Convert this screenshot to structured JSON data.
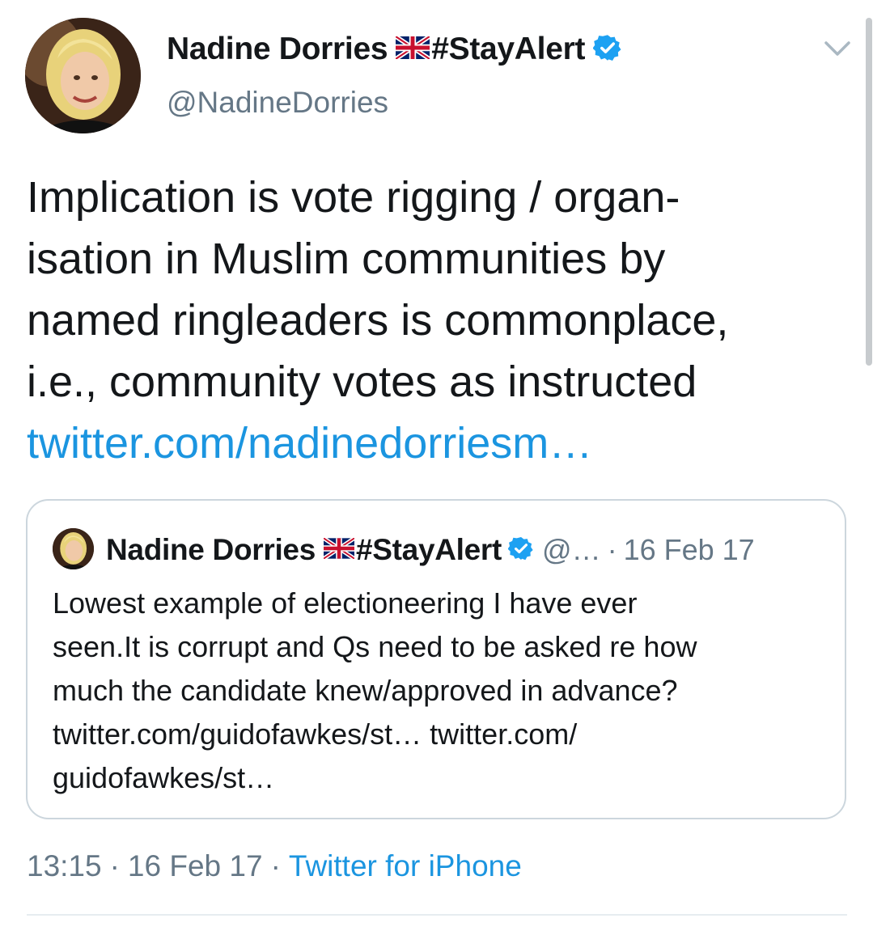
{
  "tweet": {
    "author": {
      "display_name": "Nadine Dorries",
      "flag_icon": "uk-flag-icon",
      "name_hashtag": "#StayAlert",
      "verified_icon": "verified-badge-icon",
      "handle": "@NadineDorries"
    },
    "text_lines": [
      "Implication is vote rigging / organ-",
      "isation in Muslim communities by",
      "named ringleaders is commonplace,",
      "i.e., community votes as instructed"
    ],
    "link": "twitter.com/nadinedorriesm…",
    "quoted": {
      "display_name": "Nadine Dorries",
      "name_hashtag": "#StayAlert",
      "handle": "@…",
      "separator": "·",
      "date": "16 Feb 17",
      "text_lines": [
        "Lowest example of electioneering I have ever",
        "seen.It is corrupt and Qs need to be asked re how",
        "much the candidate knew/approved in advance?",
        "twitter.com/guidofawkes/st… twitter.com/",
        "guidofawkes/st…"
      ]
    },
    "footer": {
      "time": "13:15",
      "separator": "·",
      "date": "16 Feb 17",
      "source": "Twitter for iPhone"
    },
    "menu_icon": "chevron-down-icon"
  },
  "colors": {
    "link_blue": "#1b95e0",
    "verified_blue": "#1da1f2",
    "secondary_gray": "#657786",
    "border_gray": "#ccd6dd"
  }
}
